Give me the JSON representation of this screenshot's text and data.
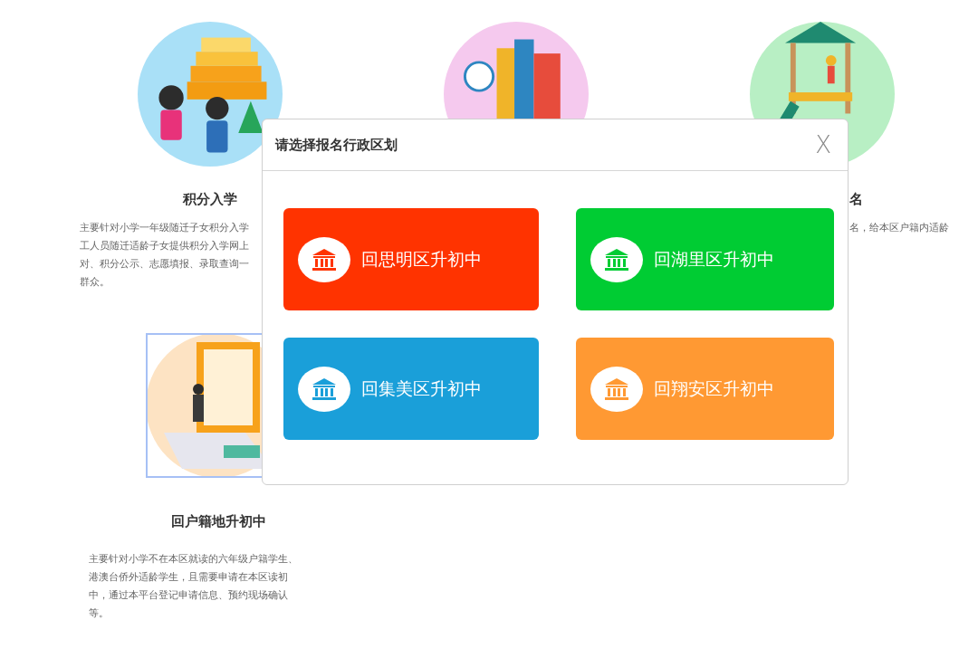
{
  "cards": [
    {
      "title": "积分入学",
      "description_lines": [
        "主要针对小学一年级随迁子女积分入学",
        "工人员随迁适龄子女提供积分入学网上",
        "对、积分公示、志愿填报、录取查询一",
        "群众。"
      ],
      "selected": false
    },
    {
      "selected": false
    },
    {
      "title": "名",
      "description_lines": [
        "名，给本区户籍内适龄"
      ],
      "selected": false
    },
    {
      "title": "回户籍地升初中",
      "description_lines": [
        "主要针对小学不在本区就读的六年级户籍学生、",
        "港澳台侨外适龄学生，且需要申请在本区读初",
        "中，通过本平台登记申请信息、预约现场确认",
        "等。"
      ],
      "selected": true
    }
  ],
  "modal": {
    "title": "请选择报名行政区划",
    "close": "X",
    "options": [
      {
        "label": "回思明区升初中",
        "color": "#ff3300"
      },
      {
        "label": "回湖里区升初中",
        "color": "#00cc33"
      },
      {
        "label": "回集美区升初中",
        "color": "#1a9fd9"
      },
      {
        "label": "回翔安区升初中",
        "color": "#ff9933"
      }
    ]
  }
}
